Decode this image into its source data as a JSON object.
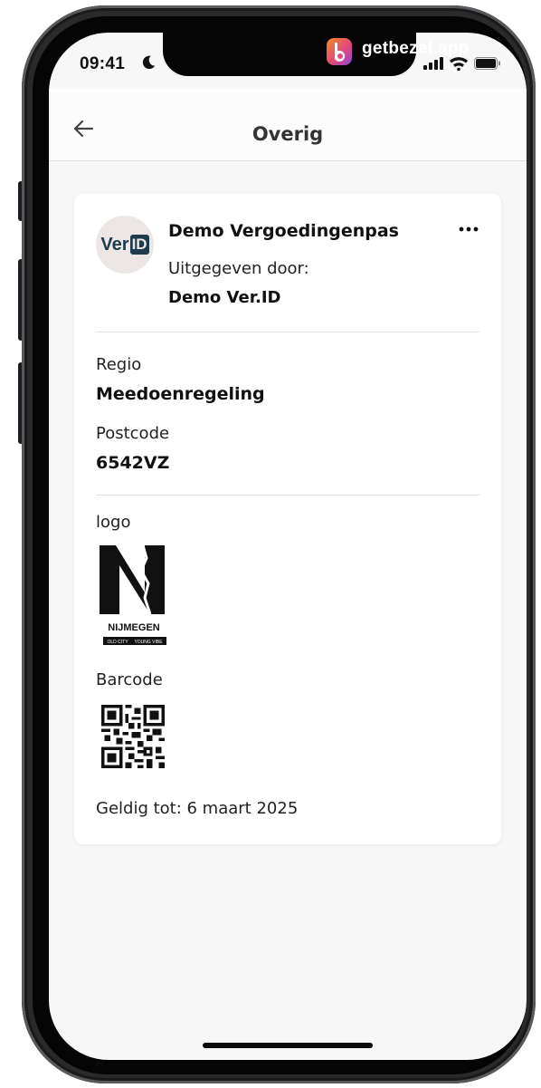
{
  "status_bar": {
    "time": "09:41",
    "bezel_url": "getbezel.app",
    "icons": [
      "moon-icon",
      "signal-icon",
      "wifi-icon",
      "battery-icon"
    ]
  },
  "header": {
    "title": "Overig",
    "back_icon": "arrow-left-icon"
  },
  "card": {
    "issuer_logo": {
      "ver": "Ver",
      "id": "ID"
    },
    "title": "Demo Vergoedingenpas",
    "issued_by_label": "Uitgegeven door:",
    "issuer_name": "Demo Ver.ID",
    "more_icon": "more-horizontal-icon",
    "fields": [
      {
        "label": "Regio",
        "value": "Meedoenregeling"
      },
      {
        "label": "Postcode",
        "value": "6542VZ"
      }
    ],
    "logo_label": "logo",
    "nijmegen_logo": {
      "city": "NIJMEGEN",
      "tagline_left": "OLD CITY",
      "tagline_right": "YOUNG VIBE"
    },
    "barcode_label": "Barcode",
    "valid_until": "Geldig tot: 6 maart 2025"
  },
  "colors": {
    "screen_background": "#f7f7f7",
    "card_background": "#ffffff",
    "verid_navy": "#1e3b4c",
    "bezel_logo_orange": "#f58a1f",
    "bezel_logo_purple": "#8e44d6"
  }
}
